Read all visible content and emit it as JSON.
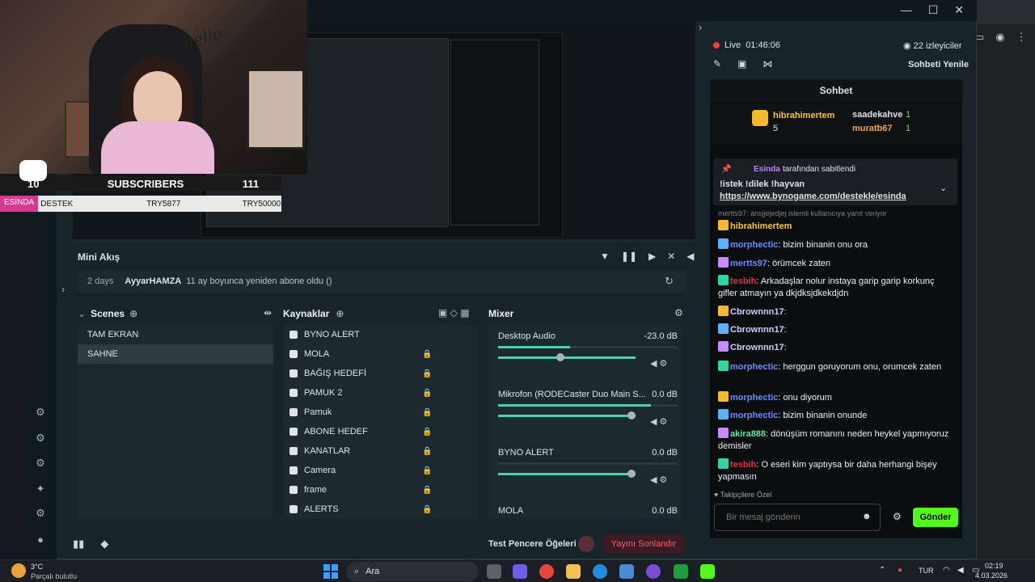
{
  "window": {
    "minimize": "—",
    "maximize": "☐",
    "close": "✕"
  },
  "overlay": {
    "hello": "hello",
    "sub_count": "10",
    "sub_label": "SUBSCRIBERS",
    "sub_goal": "111",
    "goal_tag": "ESİNDA",
    "goal_label": "DESTEK",
    "goal_current": "TRY5877",
    "goal_target": "TRY50000"
  },
  "mini_akis": {
    "title": "Mini Akış",
    "time": "2 days",
    "user": "AyyarHAMZA",
    "event": "11 ay boyunca yeniden abone oldu ()"
  },
  "scenes": {
    "title": "Scenes",
    "items": [
      "TAM EKRAN",
      "SAHNE"
    ],
    "selected": 1
  },
  "sources": {
    "title": "Kaynaklar",
    "items": [
      "BYNO ALERT",
      "MOLA",
      "BAĞIŞ HEDEFİ",
      "PAMUK 2",
      "Pamuk",
      "ABONE HEDEF",
      "KANATLAR",
      "Camera",
      "frame",
      "ALERTS"
    ]
  },
  "mixer": {
    "title": "Mixer",
    "rows": [
      {
        "name": "Desktop Audio",
        "db": "-23.0 dB",
        "level": 0.4,
        "vol": 0.45
      },
      {
        "name": "Mikrofon (RODECaster Duo Main S...",
        "db": "0.0 dB",
        "level": 0.85,
        "vol": 1
      },
      {
        "name": "BYNO ALERT",
        "db": "0.0 dB",
        "level": 0,
        "vol": 1
      },
      {
        "name": "MOLA",
        "db": "0.0 dB",
        "level": 0,
        "vol": 1
      }
    ]
  },
  "bottom": {
    "test": "Test Pencere Öğeleri",
    "end": "Yayını Sonlandır"
  },
  "stream": {
    "live": "Live",
    "time": "01:46:06",
    "viewers": "22 izleyiciler",
    "refresh": "Sohbeti Yenile"
  },
  "chat": {
    "title": "Sohbet",
    "top_gifters": [
      {
        "name": "hibrahimertem",
        "count": "5"
      },
      {
        "name": "saadekahve",
        "count": "1"
      },
      {
        "name": "muratb67",
        "count": "1"
      }
    ],
    "pinned_by_user": "Esinda",
    "pinned_by_text": "tarafından sabitlendi",
    "pinned_msg": "!istek !dilek !hayvan",
    "pinned_link": "https://www.bynogame.com/destekle/esinda",
    "reply_note": "mertts97: ansjjejedjej islemli kullanıcıya yanıt veriyor",
    "messages": [
      {
        "user": "hibrahimertem",
        "text": "",
        "color": "#f5c542"
      },
      {
        "user": "morphectic",
        "text": ": bizim binanin onu ora",
        "color": "#6b8cff"
      },
      {
        "user": "mertts97",
        "text": ": örümcek zaten",
        "color": "#6b8cff"
      },
      {
        "user": "tesbih",
        "text": ": Arkadaşlar nolur instaya garip garip korkunç gifler atmayın ya dkjdksjdkekdjdn",
        "color": "#e0314b"
      },
      {
        "user": "Cbrownnn17",
        "text": ":",
        "color": "#c7d3ff"
      },
      {
        "user": "Cbrownnn17",
        "text": ":",
        "color": "#c7d3ff"
      },
      {
        "user": "Cbrownnn17",
        "text": ":",
        "color": "#c7d3ff"
      },
      {
        "user": "morphectic",
        "text": ": herggun goruyorum onu, orumcek zaten",
        "color": "#6b8cff"
      },
      {
        "user": "morphectic",
        "text": ": onu diyorum",
        "color": "#6b8cff"
      },
      {
        "user": "morphectic",
        "text": ": bizim binanin onunde",
        "color": "#6b8cff"
      },
      {
        "user": "akira888",
        "text": ": dönüşüm romanını neden heykel yapmıyoruz demisler",
        "color": "#5ee6a3"
      },
      {
        "user": "tesbih",
        "text": ": O eseri kim yaptıysa bir daha herhangi bişey yapmasın",
        "color": "#e0314b"
      }
    ],
    "followers_only": "Takipçilere Özel",
    "input_placeholder": "Bir mesaj gönderin",
    "send": "Gönder"
  },
  "taskbar": {
    "temp": "3°C",
    "weather": "Parçalı bulutlu",
    "search": "Ara",
    "lang": "TUR",
    "time": "02:19",
    "date": "4.03.2026"
  }
}
